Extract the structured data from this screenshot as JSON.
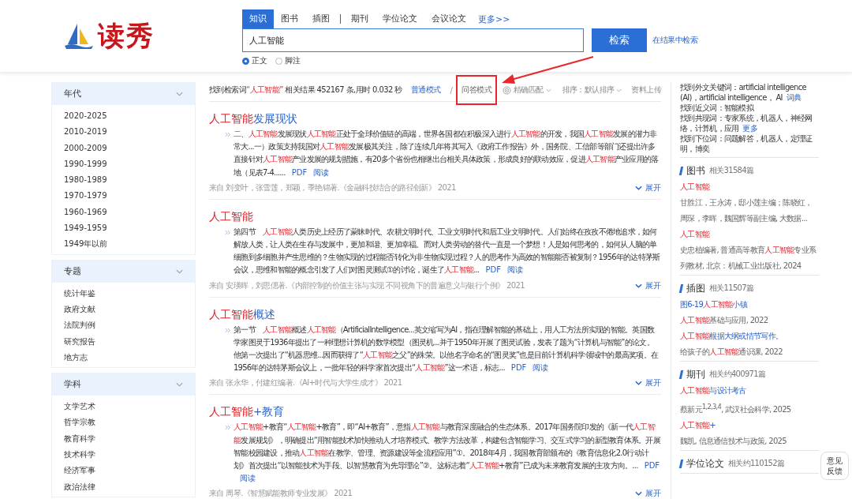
{
  "logo": {
    "text": "读秀"
  },
  "tab_groups": [
    [
      {
        "label": "知识",
        "selected": true
      },
      {
        "label": "图书",
        "selected": false
      },
      {
        "label": "插图",
        "selected": false
      }
    ],
    [
      {
        "label": "期刊",
        "selected": false
      },
      {
        "label": "学位论文",
        "selected": false
      },
      {
        "label": "会议论文",
        "selected": false
      }
    ]
  ],
  "more_link": "更多>>",
  "search": {
    "value": "人工智能",
    "button": "检索",
    "refine_link": "在结果中检索"
  },
  "scope_options": [
    {
      "label": "正文",
      "selected": true
    },
    {
      "label": "脚注",
      "selected": false
    }
  ],
  "filters": [
    {
      "title": "年代",
      "items": [
        "2020-2025",
        "2010-2019",
        "2000-2009",
        "1990-1999",
        "1980-1989",
        "1970-1979",
        "1960-1969",
        "1949-1959",
        "1949年以前"
      ]
    },
    {
      "title": "专题",
      "items": [
        "统计年鉴",
        "政府文献",
        "法院判例",
        "研究报告",
        "地方志"
      ]
    },
    {
      "title": "学科",
      "items": [
        "文学艺术",
        "哲学宗教",
        "教育科学",
        "技术科学",
        "经济军事",
        "政治法律"
      ]
    }
  ],
  "summary": [
    {
      "t": "找到检索词",
      "hit": false
    },
    {
      "t": "“人工智能”",
      "hit": true
    },
    {
      "t": " 相关结果 452167 条,用时 0.032 秒",
      "hit": false
    }
  ],
  "modes": [
    {
      "label": "普通模式",
      "selected": true,
      "highlighted": false
    },
    {
      "label": "问答模式",
      "selected": false,
      "highlighted": true
    }
  ],
  "mode_separator": "/",
  "match": "精确匹配",
  "sort": "排序：默认排序",
  "upload": "资料上传",
  "results": [
    {
      "title": [
        {
          "t": "人工智能",
          "hit": true
        },
        {
          "t": "发展现状",
          "hit": false
        }
      ],
      "snippet": [
        {
          "t": "二、",
          "hit": false
        },
        {
          "t": "人工智能",
          "hit": true
        },
        {
          "t": "发展现状",
          "hit": false
        },
        {
          "t": "人工智能",
          "hit": true
        },
        {
          "t": "正处于全球价值链的高端，世界各国都在积极深入进行",
          "hit": false
        },
        {
          "t": "人工智能",
          "hit": true
        },
        {
          "t": "的开发，我国",
          "hit": false
        },
        {
          "t": "人工智能",
          "hit": true
        },
        {
          "t": "发展的潜力非常大...一）政策支持我国对",
          "hit": false
        },
        {
          "t": "人工智能",
          "hit": true
        },
        {
          "t": "发展极其关注，除了连续几年将其写入《政府工作报告》外，国务院、工信部等部门还提出许多直接针对",
          "hit": false
        },
        {
          "t": "人工智能",
          "hit": true
        },
        {
          "t": "产业发展的规划措施，有20多个省份也相继出台相关具体政策，形成良好的联动效应，促进",
          "hit": false
        },
        {
          "t": "人工智能",
          "hit": true
        },
        {
          "t": "产业应用的落地（见表7-4......",
          "hit": false
        }
      ],
      "links": [
        "PDF",
        "阅读"
      ],
      "source": "来自 刘变叶，张雪莲，郑颖，季艳锦著.《金融科技结合的路径创新》 2021",
      "expand": "展开"
    },
    {
      "title": [
        {
          "t": "人工智能",
          "hit": true
        }
      ],
      "snippet": [
        {
          "t": "第四节　",
          "hit": false
        },
        {
          "t": "人工智能",
          "hit": true
        },
        {
          "t": "人类历史上经历了蒙昧时代、农耕文明时代、工业文明时代和后工业文明时代。人们始终在孜孜不倦地追求，如何解放人类，让人类在生存与发展中，更加和谐、更加幸福。而对人类劳动的替代一直是一个梦想！人是如何思考的，如何从人脑的单细胞到多细胞并产生思维的？生物实现的过程能否转化为非生物实现过程？人的思考作为高效的智能能否被复制？1956年的达特茅斯会议，思维和智能的概念引发了人们对图灵测试①的讨论，诞生了",
          "hit": false
        },
        {
          "t": "人工智能",
          "hit": true
        },
        {
          "t": "...",
          "hit": false
        }
      ],
      "links": [
        "PDF",
        "阅读"
      ],
      "source": "来自 安瑛晖，刘思偲著.《内部控制的价值主张与实现 不同视角下的普遍意义与银行个例》 2021",
      "expand": "展开"
    },
    {
      "title": [
        {
          "t": "人工智能",
          "hit": true
        },
        {
          "t": "概述",
          "hit": false
        }
      ],
      "snippet": [
        {
          "t": "第一节　",
          "hit": false
        },
        {
          "t": "人工智能",
          "hit": true
        },
        {
          "t": "概述",
          "hit": false
        },
        {
          "t": "人工智能",
          "hit": true
        },
        {
          "t": "（ArtificialIntelligence...英文缩写为AI，指在理解智能的基础上，用人工方法所实现的智能。英国数学家图灵于1936年提出了一种理想计算机的数学模型（图灵机...并于1950年开展了图灵试验，发表了题为“计算机与智能”的论文。他第一次提出了“机器思维...因而获得了“",
          "hit": false
        },
        {
          "t": "人工智能",
          "hit": true
        },
        {
          "t": "之父”的殊荣。以他名字命名的“图灵奖”也是目前计算机科学领域中的最高奖项。在1956年的达特茅斯会议上，一批年轻的科学家首次提出“",
          "hit": false
        },
        {
          "t": "人工智能",
          "hit": true
        },
        {
          "t": "”这一术语，标志...",
          "hit": false
        }
      ],
      "links": [
        "PDF",
        "阅读"
      ],
      "source": "来自 张永华，付建红编著.《AI+时代与大学生成才》 2021",
      "expand": "展开"
    },
    {
      "title": [
        {
          "t": "人工智能",
          "hit": true
        },
        {
          "t": "+教育",
          "hit": false
        }
      ],
      "snippet": [
        {
          "t": "人工智能",
          "hit": true
        },
        {
          "t": "+教育“",
          "hit": false
        },
        {
          "t": "人工智能",
          "hit": true
        },
        {
          "t": "+教育”，即“AI+教育”，意指",
          "hit": false
        },
        {
          "t": "人工智能",
          "hit": true
        },
        {
          "t": "与教育深度融合的生态体系。2017年国务院印发的《新一代",
          "hit": false
        },
        {
          "t": "人工智能",
          "hit": true
        },
        {
          "t": "发展规划》，明确提出“用智能技术加快推动人才培养模式、教学方法改革，构建包含智能学习、交互式学习的新型教育体系。开展智能校园建设，推动",
          "hit": false
        },
        {
          "t": "人工智能",
          "hit": true
        },
        {
          "t": "在教学、管理、资源建设等全流程应用”①。2018年4月，我国教育部颁布的《教育信息化2.0行动计划》首次提出“以智能技术为手段、以智慧教育为先导理论”②。这标志着“",
          "hit": false
        },
        {
          "t": "人工智能",
          "hit": true
        },
        {
          "t": "+教育”已成为未来教育发展的主攻方向。...",
          "hit": false
        }
      ],
      "links": [
        "PDF",
        "阅读"
      ],
      "source": "来自 周琴.《智慧赋能教师专业发展》 2021",
      "expand": "展开"
    }
  ],
  "related_terms": [
    {
      "label": "找到外文关键词：",
      "value": "artificial intelligence (AI)，artificial intelligence， AI",
      "link": "词典"
    },
    {
      "label": "找到近义词：",
      "value": "智能模拟"
    },
    {
      "label": "找到共现词：",
      "value": "专家系统，机器人，神经网络，计算机，应用",
      "link": "更多"
    },
    {
      "label": "找到下位词：",
      "value": "问题解答，机器人，定理证明，博奕"
    }
  ],
  "related_sections": [
    {
      "title": "图书",
      "count": "相关31584篇",
      "entries": [
        {
          "kind": "title",
          "segments": [
            {
              "t": "人工智能",
              "hit": true
            }
          ]
        },
        {
          "kind": "meta",
          "segments": [
            {
              "t": "甘胜江，王永涛，邸小莲主编；陈晓红，周琛，李晖，魏国辉等副主编, 大数据...",
              "hit": false
            }
          ]
        },
        {
          "kind": "title",
          "segments": [
            {
              "t": "人工智能",
              "hit": true
            }
          ]
        },
        {
          "kind": "meta",
          "segments": [
            {
              "t": "史忠植编著, 普通高等教育",
              "hit": false
            },
            {
              "t": "人工智能",
              "hit": true
            },
            {
              "t": "专业系列教材, 北京：机械工业出版社, 2024",
              "hit": false
            }
          ]
        }
      ]
    },
    {
      "title": "插图",
      "count": "相关11507篇",
      "entries": [
        {
          "kind": "title",
          "segments": [
            {
              "t": "图6-19",
              "hit": false
            },
            {
              "t": "人工智能",
              "hit": true
            },
            {
              "t": "小镇",
              "hit": false
            }
          ]
        },
        {
          "kind": "meta",
          "segments": [
            {
              "t": "人工智能",
              "hit": true
            },
            {
              "t": "基础与应用, 2022",
              "hit": false
            }
          ]
        },
        {
          "kind": "title",
          "segments": [
            {
              "t": "人工智能",
              "hit": true
            },
            {
              "t": "根据大纲或情节写作。",
              "hit": false
            }
          ]
        },
        {
          "kind": "meta",
          "segments": [
            {
              "t": "给孩子的",
              "hit": false
            },
            {
              "t": "人工智能",
              "hit": true
            },
            {
              "t": "通识课, 2022",
              "hit": false
            }
          ]
        }
      ]
    },
    {
      "title": "期刊",
      "count": "相关约400971篇",
      "entries": [
        {
          "kind": "title",
          "segments": [
            {
              "t": "人工智能",
              "hit": true
            },
            {
              "t": "与设计考古",
              "hit": false
            }
          ]
        },
        {
          "kind": "meta",
          "segments": [
            {
              "t": "蔡新元$^{1,2,3,4}$, 武汉社会科学, 2025",
              "hit": false
            }
          ]
        },
        {
          "kind": "title",
          "segments": [
            {
              "t": "人工智能",
              "hit": true
            },
            {
              "t": "+",
              "hit": false
            }
          ]
        },
        {
          "kind": "meta",
          "segments": [
            {
              "t": "魏凯, 信息通信技术与政策, 2025",
              "hit": false
            }
          ]
        }
      ]
    },
    {
      "title": "学位论文",
      "count": "相关约110152篇"
    }
  ],
  "feedback": "意见反馈"
}
